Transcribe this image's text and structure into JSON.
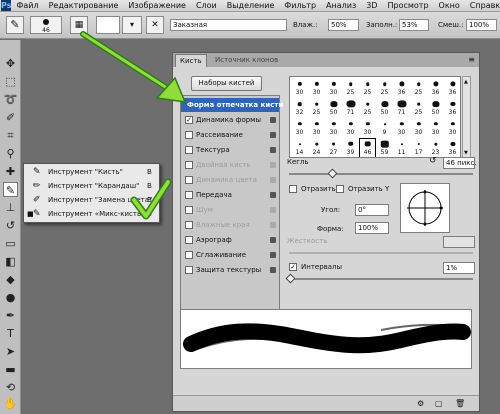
{
  "menubar": {
    "logo": "Ps",
    "items": [
      "Файл",
      "Редактирование",
      "Изображение",
      "Слои",
      "Выделение",
      "Фильтр",
      "Анализ",
      "3D",
      "Просмотр",
      "Окно",
      "Справка"
    ]
  },
  "options": {
    "brush_size": "46",
    "mode": "Заказная",
    "flow_label": "Влаж.:",
    "flow_value": "50%",
    "fill_label": "Заполн.:",
    "fill_value": "53%",
    "mix_label": "Смеш.:",
    "mix_value": "100%"
  },
  "flyout": {
    "items": [
      {
        "label": "Инструмент \"Кисть\"",
        "key": "B",
        "marked": false
      },
      {
        "label": "Инструмент \"Карандаш\"",
        "key": "B",
        "marked": false
      },
      {
        "label": "Инструмент \"Замена цвета\"",
        "key": "B",
        "marked": false
      },
      {
        "label": "Инструмент «Микс-кисть»",
        "key": "B",
        "marked": true
      }
    ]
  },
  "panel": {
    "tabs": [
      "Кисть",
      "Источник клонов"
    ],
    "presets_button": "Наборы кистей",
    "options": [
      {
        "label": "Форма отпечатка кисти",
        "header": true
      },
      {
        "label": "Динамика формы",
        "checked": true,
        "dim": false
      },
      {
        "label": "Рассеивание",
        "checked": false,
        "dim": false
      },
      {
        "label": "Текстура",
        "checked": false,
        "dim": false
      },
      {
        "label": "Двойная кисть",
        "checked": false,
        "dim": true
      },
      {
        "label": "Динамика цвета",
        "checked": false,
        "dim": true
      },
      {
        "label": "Передача",
        "checked": false,
        "dim": false
      },
      {
        "label": "Шум",
        "checked": false,
        "dim": true
      },
      {
        "label": "Влажные края",
        "checked": false,
        "dim": true
      },
      {
        "label": "Аэрограф",
        "checked": false,
        "dim": false
      },
      {
        "label": "Сглаживание",
        "checked": false,
        "dim": false
      },
      {
        "label": "Защита текстуры",
        "checked": false,
        "dim": false
      }
    ],
    "brush_grid": [
      [
        "30",
        "30",
        "30",
        "25",
        "25",
        "25",
        "36",
        "25",
        "36",
        "36"
      ],
      [
        "32",
        "25",
        "50",
        "71",
        "25",
        "50",
        "71",
        "25",
        "50",
        "36"
      ],
      [
        "30",
        "30",
        "30",
        "30",
        "30",
        "9",
        "30",
        "30",
        "30",
        "30"
      ],
      [
        "14",
        "24",
        "27",
        "39",
        "46",
        "59",
        "11",
        "17",
        "23",
        "36"
      ]
    ],
    "size_label": "Кегль",
    "size_value": "46 пикс.",
    "flip_x": "Отразить X",
    "flip_y": "Отразить Y",
    "angle_label": "Угол:",
    "angle_value": "0°",
    "roundness_label": "Форма:",
    "roundness_value": "100%",
    "hardness_label": "Жесткость",
    "spacing_label": "Интервалы",
    "spacing_checked": true,
    "spacing_value": "1%"
  }
}
